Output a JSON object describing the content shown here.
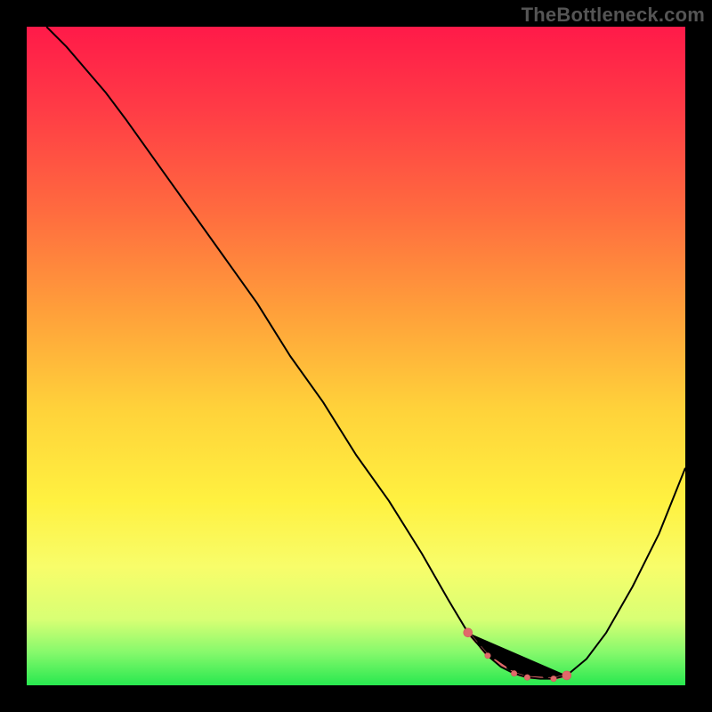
{
  "watermark": "TheBottleneck.com",
  "colors": {
    "background": "#000000",
    "curve": "#000000",
    "marker": "#e06a6a",
    "gradient_stops": [
      "#ff1a49",
      "#ff3a46",
      "#ff6b3f",
      "#ffa23a",
      "#ffd23a",
      "#fff140",
      "#f8fd6a",
      "#d8ff74",
      "#86f96c",
      "#28e84f"
    ]
  },
  "chart_data": {
    "type": "line",
    "title": "",
    "xlabel": "",
    "ylabel": "",
    "xlim": [
      0,
      100
    ],
    "ylim": [
      0,
      100
    ],
    "grid": false,
    "legend": false,
    "description": "Bottleneck-style curve: value drops from 100 at x≈3 to ≈0 near x≈70–82, then rises to ≈33 at x=100.",
    "series": [
      {
        "name": "curve",
        "x": [
          3,
          6,
          9,
          12,
          15,
          20,
          25,
          30,
          35,
          40,
          45,
          50,
          55,
          60,
          64,
          67,
          70,
          72,
          74,
          76,
          78,
          80,
          82,
          85,
          88,
          92,
          96,
          100
        ],
        "y": [
          100,
          97,
          93.5,
          90,
          86,
          79,
          72,
          65,
          58,
          50,
          43,
          35,
          28,
          20,
          13,
          8,
          4.5,
          2.8,
          1.8,
          1.2,
          1.0,
          1.0,
          1.5,
          4,
          8,
          15,
          23,
          33
        ]
      }
    ],
    "markers": {
      "note": "Salmon dashed segment highlighting the flat trough near y≈1",
      "x": [
        67,
        70,
        74,
        76,
        80,
        82
      ],
      "y": [
        8,
        4.5,
        1.8,
        1.2,
        1.0,
        1.5
      ]
    }
  }
}
